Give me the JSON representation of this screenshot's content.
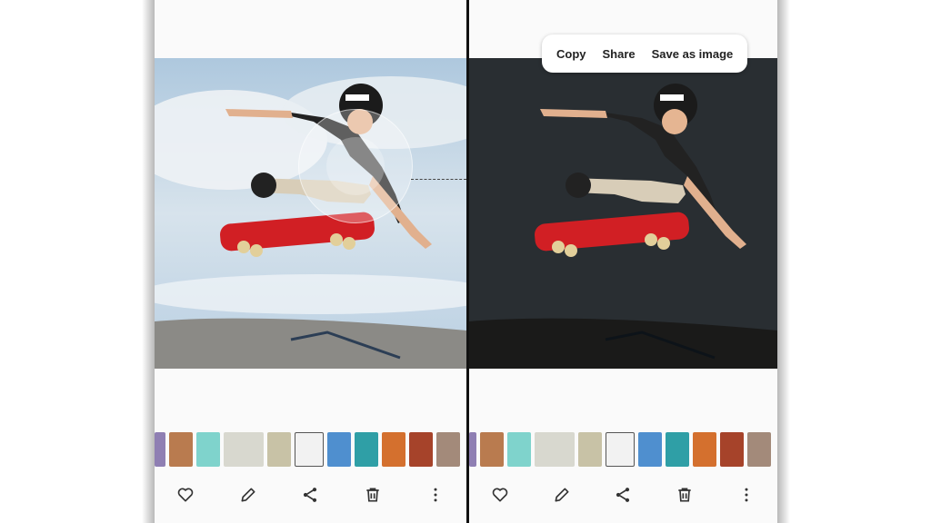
{
  "context_menu": {
    "copy": "Copy",
    "share": "Share",
    "save_as_image": "Save as image"
  },
  "toolbar_icons": [
    "heart-icon",
    "pencil-icon",
    "share-icon",
    "trash-icon",
    "more-vertical-icon"
  ],
  "thumbnail_colors": [
    "#8f7fb3",
    "#b97b4f",
    "#7fd3cc",
    "#d8d8cf",
    "#3a8fd4",
    "#c8c2a6",
    "#f2f2f2",
    "#4f8fcf",
    "#2f9fa6",
    "#d4702e",
    "#a6432a",
    "#a38a7a"
  ],
  "colors": {
    "sky": "#c9d9e8",
    "skateboard": "#d11f24",
    "icon": "#333333"
  }
}
